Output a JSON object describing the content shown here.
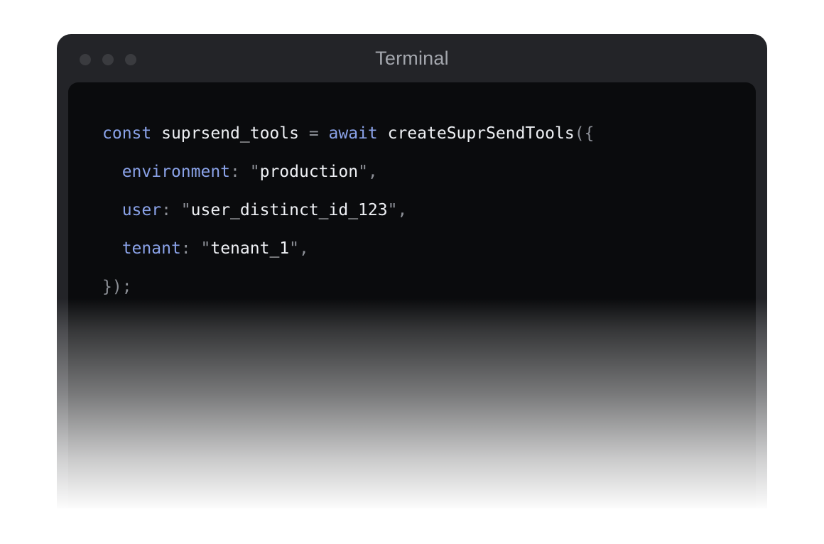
{
  "window": {
    "title": "Terminal",
    "traffic_lights": [
      "close",
      "minimize",
      "maximize"
    ]
  },
  "code": {
    "line1": {
      "kw_const": "const",
      "var": " suprsend_tools ",
      "eq": "=",
      "kw_await": " await",
      "fn": " createSuprSendTools",
      "open": "({"
    },
    "line2": {
      "indent": "  ",
      "key": "environment",
      "colon": ":",
      "q1": " \"",
      "value": "production",
      "q2": "\","
    },
    "line3": {
      "indent": "  ",
      "key": "user",
      "colon": ":",
      "q1": " \"",
      "value": "user_distinct_id_123",
      "q2": "\","
    },
    "line4": {
      "indent": "  ",
      "key": "tenant",
      "colon": ":",
      "q1": " \"",
      "value": "tenant_1",
      "q2": "\","
    },
    "line5": {
      "close": "});"
    }
  },
  "colors": {
    "window_bg": "#232428",
    "code_bg": "#0a0b0d",
    "keyword": "#8aa2e8",
    "text": "#eef0f4",
    "punctuation": "#8d9097"
  }
}
